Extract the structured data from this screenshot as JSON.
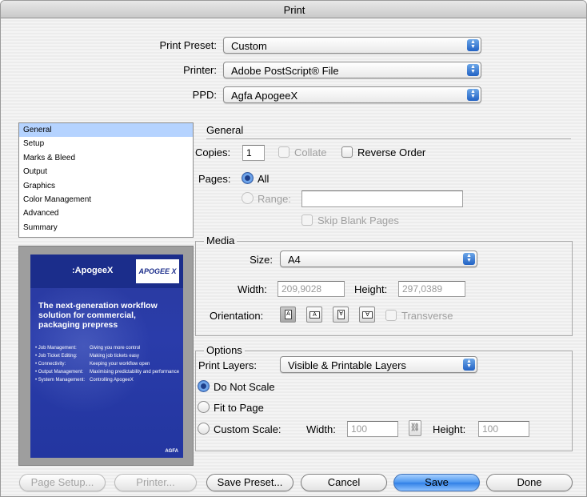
{
  "window": {
    "title": "Print"
  },
  "top": {
    "preset_label": "Print Preset:",
    "preset_value": "Custom",
    "printer_label": "Printer:",
    "printer_value": "Adobe PostScript® File",
    "ppd_label": "PPD:",
    "ppd_value": "Agfa ApogeeX"
  },
  "sidebar": {
    "items": [
      {
        "label": "General",
        "selected": true
      },
      {
        "label": "Setup"
      },
      {
        "label": "Marks & Bleed"
      },
      {
        "label": "Output"
      },
      {
        "label": "Graphics"
      },
      {
        "label": "Color Management"
      },
      {
        "label": "Advanced"
      },
      {
        "label": "Summary"
      }
    ]
  },
  "preview": {
    "brand": ":ApogeeX",
    "logo": "APOGEE X",
    "headline": "The next-generation workflow solution for commercial, packaging prepress",
    "bullets": [
      {
        "a": "• Job Management:",
        "b": "Giving you more control"
      },
      {
        "a": "• Job Ticket Editing:",
        "b": "Making job tickets easy"
      },
      {
        "a": "• Connectivity:",
        "b": "Keeping your workflow open"
      },
      {
        "a": "• Output Management:",
        "b": "Maximising predictability and performance"
      },
      {
        "a": "• System Management:",
        "b": "Controlling ApogeeX"
      }
    ],
    "footer": "AGFA"
  },
  "general": {
    "section_title": "General",
    "copies_label": "Copies:",
    "copies_value": "1",
    "collate_label": "Collate",
    "reverse_label": "Reverse Order",
    "pages_label": "Pages:",
    "all_label": "All",
    "range_label": "Range:",
    "range_value": "",
    "skip_blank_label": "Skip Blank Pages"
  },
  "media": {
    "title": "Media",
    "size_label": "Size:",
    "size_value": "A4",
    "width_label": "Width:",
    "width_value": "209,9028",
    "height_label": "Height:",
    "height_value": "297,0389",
    "orientation_label": "Orientation:",
    "transverse_label": "Transverse"
  },
  "options": {
    "title": "Options",
    "print_layers_label": "Print Layers:",
    "print_layers_value": "Visible & Printable Layers",
    "do_not_scale_label": "Do Not Scale",
    "fit_to_page_label": "Fit to Page",
    "custom_scale_label": "Custom Scale:",
    "width_label": "Width:",
    "width_value": "100",
    "height_label": "Height:",
    "height_value": "100"
  },
  "buttons": {
    "page_setup": "Page Setup...",
    "printer": "Printer...",
    "save_preset": "Save Preset...",
    "cancel": "Cancel",
    "save": "Save",
    "done": "Done"
  }
}
